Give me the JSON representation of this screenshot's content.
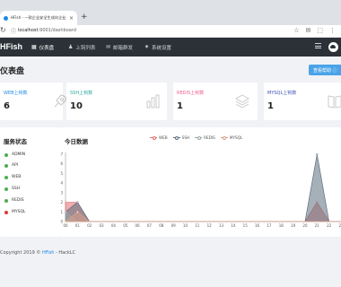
{
  "browser": {
    "tab_title": "HFish - 一款企业安全生成向企业...",
    "tab_close": "×",
    "new_tab": "+",
    "url_host": "localhost",
    "url_path": ":9001/dashboard",
    "reload_icon": "reload-icon",
    "toolbar_icons": [
      "☆",
      "✉",
      "⬚",
      "⋮"
    ]
  },
  "app": {
    "logo": "HFish",
    "nav": [
      {
        "label": "仪表盘",
        "icon": "▦",
        "active": true
      },
      {
        "label": "上钩列表",
        "icon": "♟",
        "active": false
      },
      {
        "label": "邮箱群发",
        "icon": "✉",
        "active": false
      },
      {
        "label": "系统设置",
        "icon": "✷",
        "active": false
      }
    ]
  },
  "page": {
    "title": "仪表盘",
    "help_button": "查看帮助 ⓘ"
  },
  "stats": [
    {
      "label": "WEB上钩数",
      "value": "6",
      "color": "#1e88e5",
      "icon": "rocket-icon"
    },
    {
      "label": "SSH上钩数",
      "value": "10",
      "color": "#26a69a",
      "icon": "bar-chart-icon"
    },
    {
      "label": "REDIS上钩数",
      "value": "1",
      "color": "#ef5b8a",
      "icon": "layers-icon"
    },
    {
      "label": "MYSQL上钩数",
      "value": "1",
      "color": "#3f51b5",
      "icon": "book-icon"
    }
  ],
  "services": {
    "title": "服务状态",
    "items": [
      {
        "name": "ADMIN",
        "color": "#4caf50"
      },
      {
        "name": "API",
        "color": "#4caf50"
      },
      {
        "name": "WEB",
        "color": "#4caf50"
      },
      {
        "name": "SSH",
        "color": "#4caf50"
      },
      {
        "name": "REDIS",
        "color": "#4caf50"
      },
      {
        "name": "MYSQL",
        "color": "#e53935"
      }
    ]
  },
  "chart_title": "今日数据",
  "chart_data": {
    "type": "area",
    "title": "今日数据",
    "x": [
      "00",
      "01",
      "02",
      "03",
      "04",
      "05",
      "06",
      "07",
      "08",
      "09",
      "10",
      "11",
      "12",
      "13",
      "14",
      "15",
      "16",
      "17",
      "18",
      "19",
      "20",
      "21",
      "22",
      "23"
    ],
    "ylim": [
      0,
      7
    ],
    "yticks": [
      0,
      1,
      2,
      3,
      4,
      5,
      6,
      7
    ],
    "grid": false,
    "legend_position": "top",
    "series": [
      {
        "name": "WEB",
        "color": "#e06c6c",
        "values": [
          2,
          2,
          0,
          0,
          0,
          0,
          0,
          0,
          0,
          0,
          0,
          0,
          0,
          0,
          0,
          0,
          0,
          0,
          0,
          0,
          0,
          2,
          0,
          0
        ]
      },
      {
        "name": "SSH",
        "color": "#5b6f80",
        "values": [
          1,
          2,
          0,
          0,
          0,
          0,
          0,
          0,
          0,
          0,
          0,
          0,
          0,
          0,
          0,
          0,
          0,
          0,
          0,
          0,
          0,
          7,
          0,
          0
        ]
      },
      {
        "name": "REDIS",
        "color": "#9aa8a4",
        "values": [
          1,
          0,
          0,
          0,
          0,
          0,
          0,
          0,
          0,
          0,
          0,
          0,
          0,
          0,
          0,
          0,
          0,
          0,
          0,
          0,
          0,
          0,
          0,
          0
        ]
      },
      {
        "name": "MYSQL",
        "color": "#d9a08a",
        "values": [
          0,
          1,
          0,
          0,
          0,
          0,
          0,
          0,
          0,
          0,
          0,
          0,
          0,
          0,
          0,
          0,
          0,
          0,
          0,
          0,
          0,
          0,
          0,
          0
        ]
      }
    ]
  },
  "footer": {
    "text": "Copyright 2019 © ",
    "link": "HFish",
    "rest": " - HackLC"
  }
}
